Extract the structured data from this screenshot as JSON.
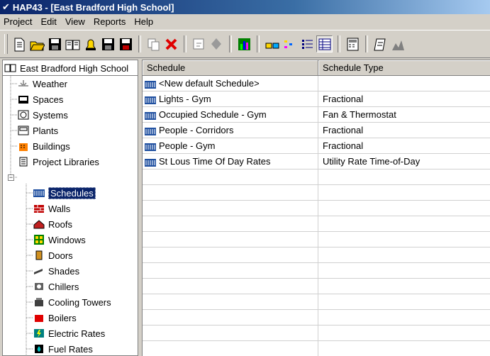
{
  "window": {
    "title": "HAP43 - [East Bradford High School]"
  },
  "menu": [
    "Project",
    "Edit",
    "View",
    "Reports",
    "Help"
  ],
  "toolbar": {
    "buttons": [
      "new-document-icon",
      "open-folder-icon",
      "save-disk-icon",
      "open-book-icon",
      "bell-icon",
      "save-disk-icon",
      "save-as-disk-icon",
      "sep",
      "copy-icon",
      "delete-x-icon",
      "sep",
      "properties-icon",
      "diamond-icon",
      "sep",
      "chart-icon",
      "sep",
      "large-icons-icon",
      "small-icons-icon",
      "list-view-icon",
      "details-view-icon",
      "sep",
      "calculator-icon",
      "sep",
      "edit-icon",
      "graph-icon"
    ],
    "pressed": "details-view-icon"
  },
  "tree": {
    "root": "East Bradford High School",
    "items": [
      {
        "label": "Weather",
        "icon": "weather-icon"
      },
      {
        "label": "Spaces",
        "icon": "spaces-icon"
      },
      {
        "label": "Systems",
        "icon": "systems-icon"
      },
      {
        "label": "Plants",
        "icon": "plants-icon"
      },
      {
        "label": "Buildings",
        "icon": "buildings-icon"
      },
      {
        "label": "Project Libraries",
        "icon": "library-icon"
      }
    ],
    "libraries": [
      {
        "label": "Schedules",
        "icon": "schedule-icon",
        "selected": true
      },
      {
        "label": "Walls",
        "icon": "wall-icon"
      },
      {
        "label": "Roofs",
        "icon": "roof-icon"
      },
      {
        "label": "Windows",
        "icon": "window-icon"
      },
      {
        "label": "Doors",
        "icon": "door-icon"
      },
      {
        "label": "Shades",
        "icon": "shade-icon"
      },
      {
        "label": "Chillers",
        "icon": "chiller-icon"
      },
      {
        "label": "Cooling Towers",
        "icon": "cooling-tower-icon"
      },
      {
        "label": "Boilers",
        "icon": "boiler-icon"
      },
      {
        "label": "Electric Rates",
        "icon": "electric-rate-icon"
      },
      {
        "label": "Fuel Rates",
        "icon": "fuel-rate-icon"
      }
    ]
  },
  "grid": {
    "columns": [
      "Schedule",
      "Schedule Type"
    ],
    "rows": [
      {
        "name": "<New default Schedule>",
        "type": ""
      },
      {
        "name": "Lights - Gym",
        "type": "Fractional"
      },
      {
        "name": "Occupied Schedule - Gym",
        "type": "Fan & Thermostat"
      },
      {
        "name": "People - Corridors",
        "type": "Fractional"
      },
      {
        "name": "People - Gym",
        "type": "Fractional"
      },
      {
        "name": "St Lous Time Of Day Rates",
        "type": "Utility Rate Time-of-Day"
      }
    ],
    "empty_rows": 12
  }
}
